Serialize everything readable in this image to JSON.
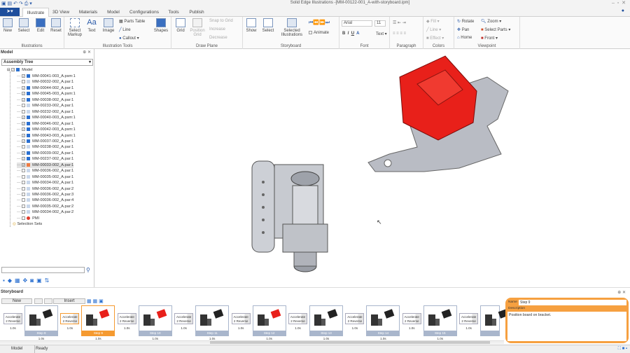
{
  "window": {
    "title": "Solid Edge Illustrations -[MM-00122-001_A-with-storyboard.ipm]"
  },
  "tabs": [
    {
      "label": "Illustrate",
      "active": true
    },
    {
      "label": "3D View"
    },
    {
      "label": "Materials"
    },
    {
      "label": "Model"
    },
    {
      "label": "Configurations"
    },
    {
      "label": "Tools"
    },
    {
      "label": "Publish"
    }
  ],
  "ribbon": {
    "illustrations": {
      "label": "Illustrations",
      "buttons": [
        "New",
        "Select",
        "Edit",
        "Reset"
      ]
    },
    "illustration_tools": {
      "label": "Illustration Tools",
      "select_markup": "Select Markup",
      "text": "Text",
      "image": "Image",
      "parts_table": "Parts Table",
      "line": "Line",
      "callout": "Callout",
      "shapes": "Shapes"
    },
    "draw_plane": {
      "label": "Draw Plane",
      "grid": "Grid",
      "position_grid": "Position Grid",
      "snap": "Snap to Grid",
      "increase": "Increase",
      "decrease": "Decrease"
    },
    "storyboard": {
      "label": "Storyboard",
      "show": "Show",
      "select": "Select",
      "selected": "Selected Illustrations",
      "animate": "Animate"
    },
    "font": {
      "label": "Font",
      "name": "Arial",
      "size": "11",
      "text": "Text"
    },
    "paragraph": {
      "label": "Paragraph"
    },
    "colors": {
      "label": "Colors",
      "fill": "Fill",
      "line": "Line",
      "effect": "Effect"
    },
    "viewpoint": {
      "label": "Viewpoint",
      "rotate": "Rotate",
      "pan": "Pan",
      "home": "Home",
      "zoom": "Zoom",
      "select_parts": "Select Parts",
      "front": "Front"
    }
  },
  "left_panel": {
    "title": "Model",
    "dropdown": "Assembly Tree",
    "root": "Model",
    "items": [
      {
        "name": "MM-00041-003_A.psm:1",
        "checked": true
      },
      {
        "name": "MM-00032-002_A.par:1",
        "checked": false
      },
      {
        "name": "MM-00044-002_A.par:1",
        "checked": true
      },
      {
        "name": "MM-00045-003_A.psm:1",
        "checked": true
      },
      {
        "name": "MM-00038-002_A.par:1",
        "checked": true
      },
      {
        "name": "MM-00233-002_A.par:1",
        "checked": false
      },
      {
        "name": "MM-00232-002_A.par:1",
        "checked": false
      },
      {
        "name": "MM-00040-003_A.psm:1",
        "checked": true
      },
      {
        "name": "MM-00046-002_A.par:1",
        "checked": true
      },
      {
        "name": "MM-00042-003_A.psm:1",
        "checked": true
      },
      {
        "name": "MM-00043-003_A.psm:1",
        "checked": true
      },
      {
        "name": "MM-00037-002_A.par:1",
        "checked": true
      },
      {
        "name": "MM-00238-002_A.par:1",
        "checked": false
      },
      {
        "name": "MM-00039-002_A.par:1",
        "checked": true
      },
      {
        "name": "MM-00237-002_A.par:1",
        "checked": true
      },
      {
        "name": "MM-00033-002_A.par:1",
        "checked": true,
        "selected": true
      },
      {
        "name": "MM-00036-002_A.par:1",
        "checked": false
      },
      {
        "name": "MM-00035-002_A.par:1",
        "checked": false
      },
      {
        "name": "MM-00034-002_A.par:1",
        "checked": false
      },
      {
        "name": "MM-00036-002_A.par:2",
        "checked": false
      },
      {
        "name": "MM-00036-002_A.par:3",
        "checked": false
      },
      {
        "name": "MM-00036-002_A.par:4",
        "checked": false
      },
      {
        "name": "MM-00035-002_A.par:2",
        "checked": false
      },
      {
        "name": "MM-00034-002_A.par:2",
        "checked": false
      },
      {
        "name": "PMI",
        "checked": false
      }
    ],
    "selection_sets": "Selection Sets",
    "search_value": ""
  },
  "storyboard": {
    "title": "Storyboard",
    "new": "New",
    "insert": "Insert",
    "transition": {
      "line1": "Accelerate",
      "line2": "2 Reverse",
      "duration": "1.0s"
    },
    "steps": [
      {
        "label": "Step 8",
        "duration": "1.0s"
      },
      {
        "label": "Step 9",
        "duration": "1.0s",
        "selected": true
      },
      {
        "label": "Step 10",
        "duration": "1.0s"
      },
      {
        "label": "Step 11",
        "duration": "1.0s"
      },
      {
        "label": "Step 12",
        "duration": "1.0s"
      },
      {
        "label": "Step 13",
        "duration": "1.0s"
      },
      {
        "label": "Step 14",
        "duration": "1.0s"
      },
      {
        "label": "Step 15",
        "duration": "1.0s"
      }
    ],
    "properties": {
      "name_label": "Name",
      "name_value": "Step 9",
      "description_label": "Description",
      "description_value": "Position board on bracket."
    }
  },
  "status": {
    "tab": "Model",
    "text": "Ready"
  },
  "colors": {
    "accent": "#f59a30",
    "highlight_part": "#e8201a",
    "app_blue": "#1e4e9c"
  }
}
